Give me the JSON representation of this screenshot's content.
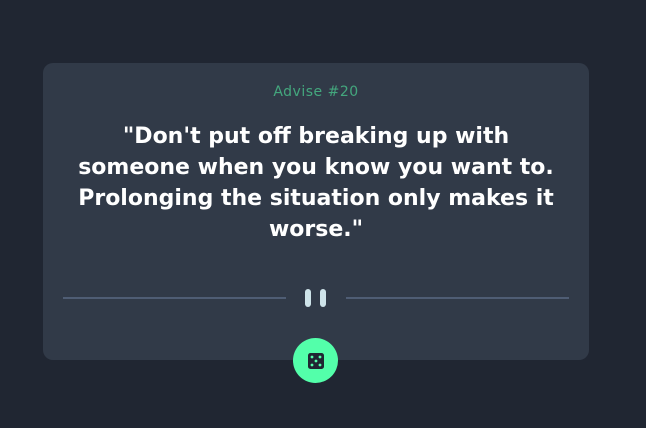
{
  "advice": {
    "id_label": "Advise #20",
    "quote": "\"Don't put off breaking up with someone when you know you want to. Prolonging the situation only makes it worse.\""
  },
  "colors": {
    "background": "#202632",
    "card": "#313a48",
    "accent": "#53ffaa",
    "divider": "#4f5d74",
    "text": "#ffffff"
  },
  "icons": {
    "divider_icon": "pause-icon",
    "button_icon": "dice-icon"
  }
}
